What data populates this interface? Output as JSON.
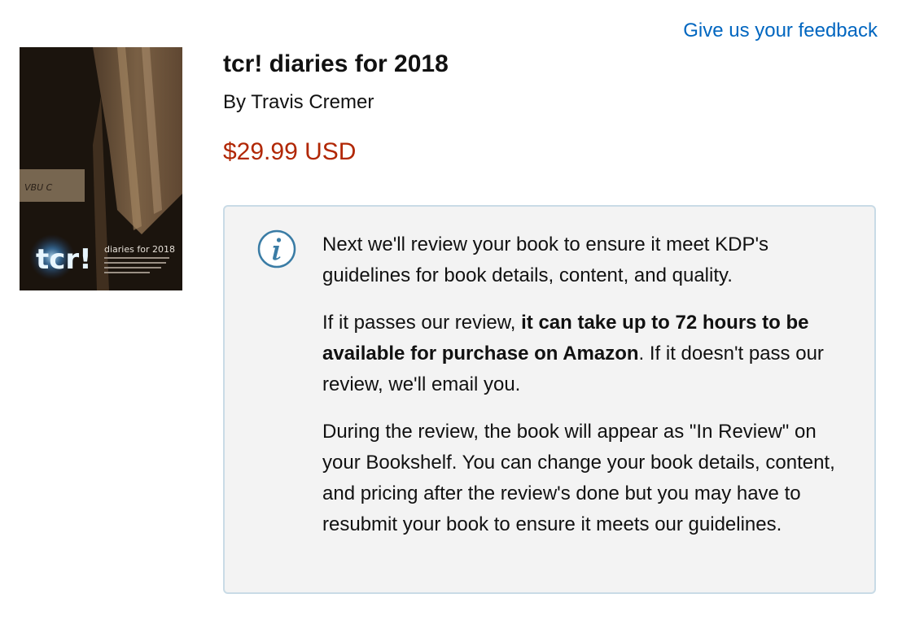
{
  "header": {
    "feedback_link": "Give us your feedback"
  },
  "book": {
    "cover": {
      "label_tcr": "tcr!",
      "label_title": "diaries for 2018",
      "label_sticker": "VBU C"
    },
    "title": "tcr! diaries for 2018",
    "author": "By Travis Cremer",
    "price": "$29.99 USD"
  },
  "notice": {
    "icon": "info-icon",
    "p1": "Next we'll review your book to ensure it meet KDP's guidelines for book details, content, and quality.",
    "p2_pre": "If it passes our review, ",
    "p2_bold": "it can take up to 72 hours to be available for purchase on Amazon",
    "p2_post": ". If it doesn't pass our review, we'll email you.",
    "p3": "During the review, the book will appear as \"In Review\" on your Bookshelf. You can change your book details, content, and pricing after the review's done but you may have to resubmit your book to ensure it meets our guidelines."
  },
  "colors": {
    "link": "#0066c0",
    "price": "#b12704",
    "notice_bg": "#f3f3f3",
    "notice_border": "#c9dbe6",
    "icon": "#3a7ca5"
  }
}
